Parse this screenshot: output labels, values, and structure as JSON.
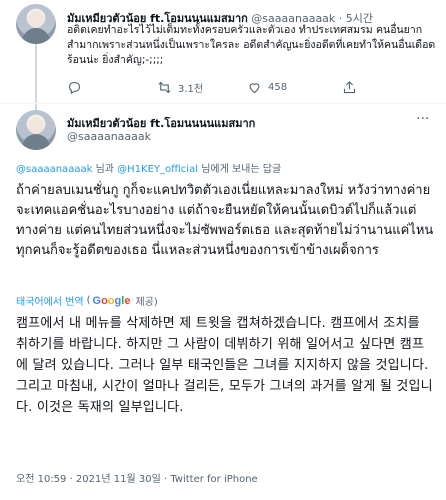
{
  "previous_tweet": {
    "display_name": "มัมเหมียวตัวน้อย ft.โอมนนนแมสมาก",
    "handle": "@saaaanaaaak",
    "time_sep": "·",
    "time": "5시간",
    "text": "อติดเคยทำอะไรไว้ไม่เต็มทะทั้งครอบครัวและตัวเอง ทำประเทศสมรม คนอื่นยาก สำมากเพราะส่วนหนึ่งเป็นเพราะใครละ อดีตสำคัญนะยิ่งอดีตที่เคยทำให้คนอื่นเดือดร้อนน่ะ ยิ่งสำคัญ;-;;;;",
    "retweets": "3.1천",
    "likes": "458"
  },
  "tweet": {
    "display_name": "มัมเหมียวตัวน้อย ft.โอมนนนนแมสมาก",
    "handle": "@saaaanaaaak",
    "reply_handle_1": "@saaaanaaaak",
    "reply_connector": "님과",
    "reply_handle_2": "@H1KEY_official",
    "reply_suffix": "님에게 보내는 답글",
    "thai_text": "ถ้าค่ายลบเมนชั่นกู กูก็จะแคปทวิตตัวเองเนี่ยแหละมาลงใหม่ หวังว่าทางค่ายจะเทคแอคชั่นอะไรบางอย่าง แต่ถ้าจะยืนหยัดให้คนนั้นเดบิวต์ไปก็แล้วแต่ทางค่าย แต่คนไทยส่วนหนึ่งจะไม่ซัพพอร์ตเธอ และสุดท้ายไม่ว่านานแค่ไหนทุกคนก็จะรู้อดีตของเธอ นี่แหละส่วนหนึ่งของการเข้าข้างเผด็จการ",
    "translated_from": "태국어에서 번역",
    "translated_by_open": "(",
    "google": "Google",
    "translated_by_close": "제공)",
    "korean_text": "캠프에서 내 메뉴를 삭제하면 제 트윗을 캡쳐하겠습니다. 캠프에서 조치를 취하기를 바랍니다. 하지만 그 사람이 데뷔하기 위해 일어서고 싶다면 캠프에 달려 있습니다. 그러나 일부 태국인들은 그녀를 지지하지 않을 것입니다. 그리고 마침내, 시간이 얼마나 걸리든, 모두가 그녀의 과거를 알게 될 것입니다. 이것은 독재의 일부입니다.",
    "timestamp": "오전 10:59 · 2021년 11월 30일 · Twitter for iPhone"
  },
  "icons": {
    "reply": "reply-icon",
    "retweet": "retweet-icon",
    "like": "heart-icon",
    "share": "share-icon",
    "more": "more-icon"
  },
  "colors": {
    "link": "#1d9bf0",
    "secondary": "#536471",
    "text": "#0f1419"
  }
}
